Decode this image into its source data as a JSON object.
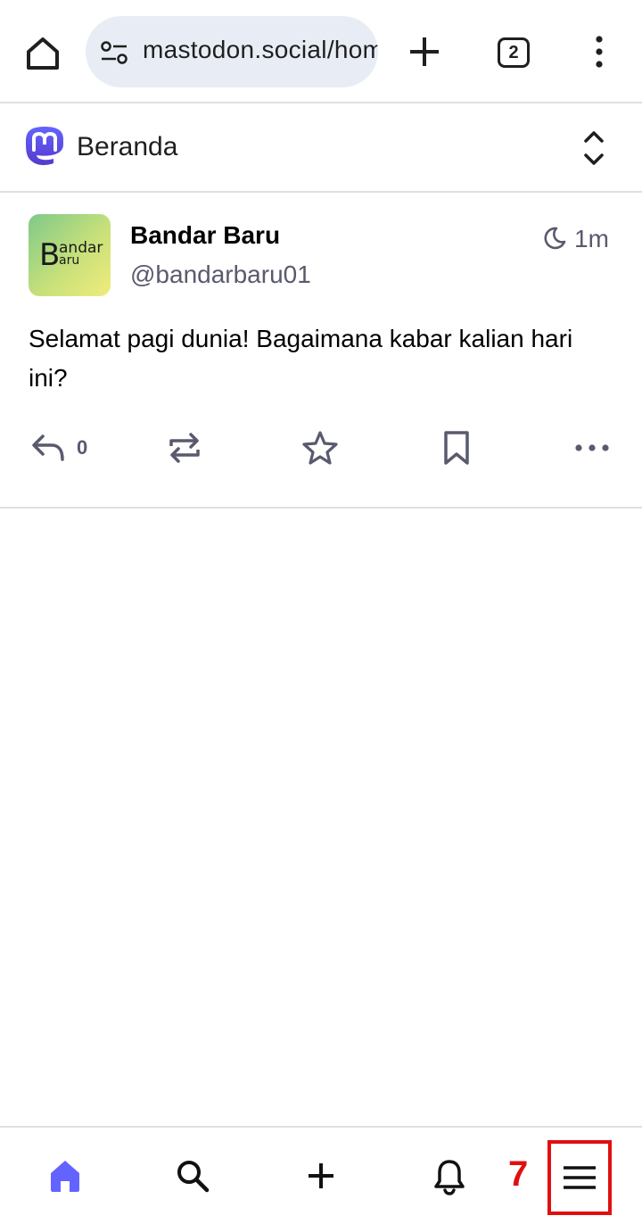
{
  "browser": {
    "url": "mastodon.social/home",
    "tab_count": "2",
    "icons": [
      "home-icon",
      "site-settings-icon",
      "new-tab-icon",
      "tab-switcher-icon",
      "more-vert-icon"
    ]
  },
  "column": {
    "title": "Beranda"
  },
  "post": {
    "display_name": "Bandar Baru",
    "handle": "@bandarbaru01",
    "timestamp": "1m",
    "content": "Selamat pagi dunia! Bagaimana kabar kalian hari ini?",
    "reply_count": "0",
    "avatar": {
      "letter": "B",
      "line1": "andar",
      "line2": "aru"
    }
  },
  "bottom_nav": {
    "items": [
      "home",
      "search",
      "compose",
      "notifications",
      "menu"
    ],
    "annotation": "7"
  },
  "colors": {
    "accent": "#6364ff",
    "icon_muted": "#5a5a6e",
    "highlight": "#e01010"
  }
}
